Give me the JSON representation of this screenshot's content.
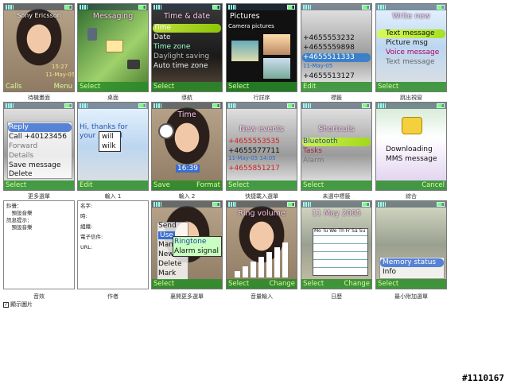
{
  "watermark": "#1110167",
  "checkbox": {
    "label": "顯示圖片",
    "checked": true
  },
  "screens": [
    {
      "caption": "待機畫面",
      "title": "Sony Ericsson",
      "left": "Calls",
      "right": "Menu",
      "extra": [
        "15:27",
        "11-May-05"
      ]
    },
    {
      "caption": "桌面",
      "title": "Messaging",
      "left": "Select",
      "right": ""
    },
    {
      "caption": "導航",
      "title": "Time & date",
      "left": "Select",
      "right": "",
      "items": [
        "Time",
        "Date",
        "Time zone",
        "Daylight saving",
        "Auto time zone"
      ]
    },
    {
      "caption": "行詳序",
      "title": "Pictures",
      "left": "Select",
      "right": "",
      "items": [
        "Camera pictures"
      ]
    },
    {
      "caption": "標籤",
      "title": "",
      "left": "Edit",
      "right": "",
      "items": [
        "+4655553232",
        "+4655559898",
        "+4655511333",
        "11-May-05",
        "+4655513127"
      ]
    },
    {
      "caption": "跳出視窗",
      "title": "Write new",
      "left": "Select",
      "right": "",
      "items": [
        "Text message",
        "Picture msg",
        "Voice message",
        "Text message"
      ]
    },
    {
      "caption": "更多選單",
      "title": "",
      "left": "Select",
      "right": "",
      "items": [
        "Reply",
        "Call +40123456",
        "Forward",
        "Details",
        "Save message",
        "Delete"
      ]
    },
    {
      "caption": "輸入 1",
      "title": "",
      "left": "Edit",
      "right": "",
      "items": [
        "Hi, thanks for",
        "your party. I"
      ],
      "popup": [
        "will",
        "wilk"
      ]
    },
    {
      "caption": "輸入 2",
      "title": "Time",
      "left": "Save",
      "right": "Format",
      "items": [
        "16:39"
      ]
    },
    {
      "caption": "快捷載入選單",
      "title": "New events",
      "left": "Select",
      "right": "",
      "items": [
        "+4655553535",
        "+4655577711",
        "11-May-05 14:05",
        "+4655851217"
      ]
    },
    {
      "caption": "未選中標籤",
      "title": "Shortcuts",
      "left": "Select",
      "right": "",
      "items": [
        "Bluetooth",
        "Tasks",
        "Alarm"
      ]
    },
    {
      "caption": "綜合",
      "title": "",
      "left": "",
      "right": "Cancel",
      "items": [
        "Downloading",
        "MMS message"
      ]
    },
    {
      "caption": "音效",
      "title": "",
      "left": "",
      "right": ""
    },
    {
      "caption": "作者",
      "title": "",
      "left": "",
      "right": ""
    },
    {
      "caption": "裏開更多選單",
      "title": "",
      "left": "Select",
      "right": "",
      "items": [
        "Send",
        "Use",
        "Man",
        "New",
        "Delete",
        "Mark"
      ],
      "submenu": [
        "Ringtone",
        "Alarm signal"
      ]
    },
    {
      "caption": "音量輸入",
      "title": "Ring volume",
      "left": "Select",
      "right": "Change"
    },
    {
      "caption": "日歷",
      "title": "11 May 2005",
      "left": "Select",
      "right": "Change",
      "items": [
        "Mo Tu We Th Fr Sa Su"
      ]
    },
    {
      "caption": "最小附加選單",
      "title": "",
      "left": "Select",
      "right": "",
      "items": [
        "Memory status",
        "Info"
      ]
    }
  ],
  "panel_left": {
    "lines": [
      "鈴聲：",
      "　預設音樂",
      "訊息提示：",
      "　預設音樂"
    ]
  },
  "panel_right": {
    "lines": [
      "名字:",
      "時:",
      "組織:",
      "電子信件:",
      "URL:"
    ]
  }
}
